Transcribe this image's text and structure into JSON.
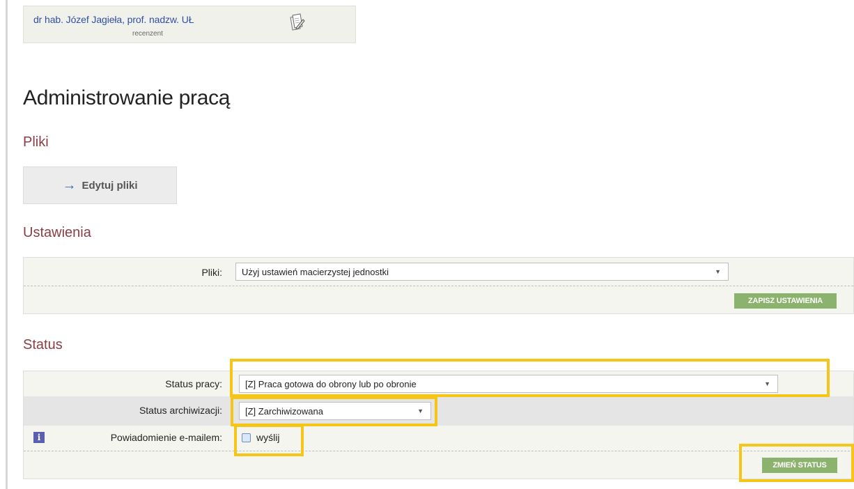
{
  "reviewer": {
    "name": "dr hab. Józef Jagieła, prof. nadzw. UŁ",
    "role": "recenzent"
  },
  "page_title": "Administrowanie pracą",
  "files_section": {
    "title": "Pliki",
    "edit_button": "Edytuj pliki"
  },
  "settings_section": {
    "title": "Ustawienia",
    "files_label": "Pliki:",
    "files_value": "Użyj ustawień macierzystej jednostki",
    "save_button": "ZAPISZ USTAWIENIA"
  },
  "status_section": {
    "title": "Status",
    "work_status_label": "Status pracy:",
    "work_status_value": "[Z] Praca gotowa do obrony lub po obronie",
    "archive_status_label": "Status archiwizacji:",
    "archive_status_value": "[Z] Zarchiwizowana",
    "email_label": "Powiadomienie e-mailem:",
    "email_checkbox_label": "wyślij",
    "email_checked": false,
    "change_button": "ZMIEŃ STATUS"
  },
  "colors": {
    "section_title": "#8b3d45",
    "green_button": "#8cb36d",
    "highlight": "#f5c518",
    "link_blue": "#2f4fa3"
  },
  "icons": {
    "reviewer_action": "edit-review-icon",
    "edit_files": "arrow-right-icon",
    "info": "info-icon",
    "dropdown": "caret-down-icon"
  }
}
